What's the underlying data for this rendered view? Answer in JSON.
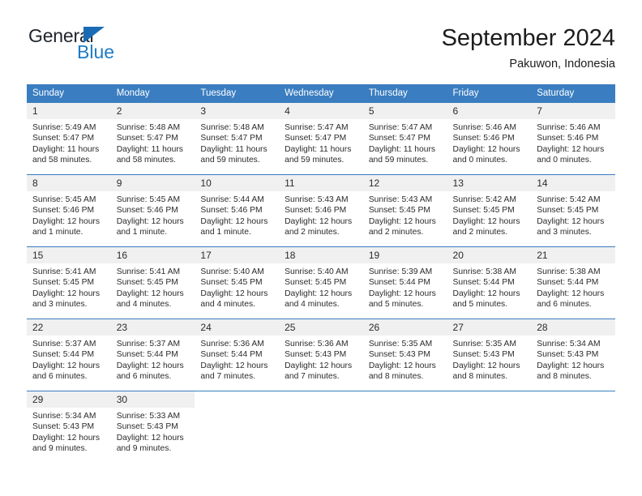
{
  "logo": {
    "word_top": "General",
    "word_bottom": "Blue",
    "triangle_color": "#1a6bb5",
    "blue_color": "#1f7bc4"
  },
  "header": {
    "title": "September 2024",
    "location": "Pakuwon, Indonesia"
  },
  "theme": {
    "header_blue": "#3a7dc0",
    "day_band_gray": "#f0f0f0",
    "text": "#2b2b2b"
  },
  "weekday_headers": [
    "Sunday",
    "Monday",
    "Tuesday",
    "Wednesday",
    "Thursday",
    "Friday",
    "Saturday"
  ],
  "weeks": [
    [
      {
        "day": "1",
        "sunrise": "Sunrise: 5:49 AM",
        "sunset": "Sunset: 5:47 PM",
        "daylight_l1": "Daylight: 11 hours",
        "daylight_l2": "and 58 minutes."
      },
      {
        "day": "2",
        "sunrise": "Sunrise: 5:48 AM",
        "sunset": "Sunset: 5:47 PM",
        "daylight_l1": "Daylight: 11 hours",
        "daylight_l2": "and 58 minutes."
      },
      {
        "day": "3",
        "sunrise": "Sunrise: 5:48 AM",
        "sunset": "Sunset: 5:47 PM",
        "daylight_l1": "Daylight: 11 hours",
        "daylight_l2": "and 59 minutes."
      },
      {
        "day": "4",
        "sunrise": "Sunrise: 5:47 AM",
        "sunset": "Sunset: 5:47 PM",
        "daylight_l1": "Daylight: 11 hours",
        "daylight_l2": "and 59 minutes."
      },
      {
        "day": "5",
        "sunrise": "Sunrise: 5:47 AM",
        "sunset": "Sunset: 5:47 PM",
        "daylight_l1": "Daylight: 11 hours",
        "daylight_l2": "and 59 minutes."
      },
      {
        "day": "6",
        "sunrise": "Sunrise: 5:46 AM",
        "sunset": "Sunset: 5:46 PM",
        "daylight_l1": "Daylight: 12 hours",
        "daylight_l2": "and 0 minutes."
      },
      {
        "day": "7",
        "sunrise": "Sunrise: 5:46 AM",
        "sunset": "Sunset: 5:46 PM",
        "daylight_l1": "Daylight: 12 hours",
        "daylight_l2": "and 0 minutes."
      }
    ],
    [
      {
        "day": "8",
        "sunrise": "Sunrise: 5:45 AM",
        "sunset": "Sunset: 5:46 PM",
        "daylight_l1": "Daylight: 12 hours",
        "daylight_l2": "and 1 minute."
      },
      {
        "day": "9",
        "sunrise": "Sunrise: 5:45 AM",
        "sunset": "Sunset: 5:46 PM",
        "daylight_l1": "Daylight: 12 hours",
        "daylight_l2": "and 1 minute."
      },
      {
        "day": "10",
        "sunrise": "Sunrise: 5:44 AM",
        "sunset": "Sunset: 5:46 PM",
        "daylight_l1": "Daylight: 12 hours",
        "daylight_l2": "and 1 minute."
      },
      {
        "day": "11",
        "sunrise": "Sunrise: 5:43 AM",
        "sunset": "Sunset: 5:46 PM",
        "daylight_l1": "Daylight: 12 hours",
        "daylight_l2": "and 2 minutes."
      },
      {
        "day": "12",
        "sunrise": "Sunrise: 5:43 AM",
        "sunset": "Sunset: 5:45 PM",
        "daylight_l1": "Daylight: 12 hours",
        "daylight_l2": "and 2 minutes."
      },
      {
        "day": "13",
        "sunrise": "Sunrise: 5:42 AM",
        "sunset": "Sunset: 5:45 PM",
        "daylight_l1": "Daylight: 12 hours",
        "daylight_l2": "and 2 minutes."
      },
      {
        "day": "14",
        "sunrise": "Sunrise: 5:42 AM",
        "sunset": "Sunset: 5:45 PM",
        "daylight_l1": "Daylight: 12 hours",
        "daylight_l2": "and 3 minutes."
      }
    ],
    [
      {
        "day": "15",
        "sunrise": "Sunrise: 5:41 AM",
        "sunset": "Sunset: 5:45 PM",
        "daylight_l1": "Daylight: 12 hours",
        "daylight_l2": "and 3 minutes."
      },
      {
        "day": "16",
        "sunrise": "Sunrise: 5:41 AM",
        "sunset": "Sunset: 5:45 PM",
        "daylight_l1": "Daylight: 12 hours",
        "daylight_l2": "and 4 minutes."
      },
      {
        "day": "17",
        "sunrise": "Sunrise: 5:40 AM",
        "sunset": "Sunset: 5:45 PM",
        "daylight_l1": "Daylight: 12 hours",
        "daylight_l2": "and 4 minutes."
      },
      {
        "day": "18",
        "sunrise": "Sunrise: 5:40 AM",
        "sunset": "Sunset: 5:45 PM",
        "daylight_l1": "Daylight: 12 hours",
        "daylight_l2": "and 4 minutes."
      },
      {
        "day": "19",
        "sunrise": "Sunrise: 5:39 AM",
        "sunset": "Sunset: 5:44 PM",
        "daylight_l1": "Daylight: 12 hours",
        "daylight_l2": "and 5 minutes."
      },
      {
        "day": "20",
        "sunrise": "Sunrise: 5:38 AM",
        "sunset": "Sunset: 5:44 PM",
        "daylight_l1": "Daylight: 12 hours",
        "daylight_l2": "and 5 minutes."
      },
      {
        "day": "21",
        "sunrise": "Sunrise: 5:38 AM",
        "sunset": "Sunset: 5:44 PM",
        "daylight_l1": "Daylight: 12 hours",
        "daylight_l2": "and 6 minutes."
      }
    ],
    [
      {
        "day": "22",
        "sunrise": "Sunrise: 5:37 AM",
        "sunset": "Sunset: 5:44 PM",
        "daylight_l1": "Daylight: 12 hours",
        "daylight_l2": "and 6 minutes."
      },
      {
        "day": "23",
        "sunrise": "Sunrise: 5:37 AM",
        "sunset": "Sunset: 5:44 PM",
        "daylight_l1": "Daylight: 12 hours",
        "daylight_l2": "and 6 minutes."
      },
      {
        "day": "24",
        "sunrise": "Sunrise: 5:36 AM",
        "sunset": "Sunset: 5:44 PM",
        "daylight_l1": "Daylight: 12 hours",
        "daylight_l2": "and 7 minutes."
      },
      {
        "day": "25",
        "sunrise": "Sunrise: 5:36 AM",
        "sunset": "Sunset: 5:43 PM",
        "daylight_l1": "Daylight: 12 hours",
        "daylight_l2": "and 7 minutes."
      },
      {
        "day": "26",
        "sunrise": "Sunrise: 5:35 AM",
        "sunset": "Sunset: 5:43 PM",
        "daylight_l1": "Daylight: 12 hours",
        "daylight_l2": "and 8 minutes."
      },
      {
        "day": "27",
        "sunrise": "Sunrise: 5:35 AM",
        "sunset": "Sunset: 5:43 PM",
        "daylight_l1": "Daylight: 12 hours",
        "daylight_l2": "and 8 minutes."
      },
      {
        "day": "28",
        "sunrise": "Sunrise: 5:34 AM",
        "sunset": "Sunset: 5:43 PM",
        "daylight_l1": "Daylight: 12 hours",
        "daylight_l2": "and 8 minutes."
      }
    ],
    [
      {
        "day": "29",
        "sunrise": "Sunrise: 5:34 AM",
        "sunset": "Sunset: 5:43 PM",
        "daylight_l1": "Daylight: 12 hours",
        "daylight_l2": "and 9 minutes."
      },
      {
        "day": "30",
        "sunrise": "Sunrise: 5:33 AM",
        "sunset": "Sunset: 5:43 PM",
        "daylight_l1": "Daylight: 12 hours",
        "daylight_l2": "and 9 minutes."
      },
      {
        "day": "",
        "sunrise": "",
        "sunset": "",
        "daylight_l1": "",
        "daylight_l2": ""
      },
      {
        "day": "",
        "sunrise": "",
        "sunset": "",
        "daylight_l1": "",
        "daylight_l2": ""
      },
      {
        "day": "",
        "sunrise": "",
        "sunset": "",
        "daylight_l1": "",
        "daylight_l2": ""
      },
      {
        "day": "",
        "sunrise": "",
        "sunset": "",
        "daylight_l1": "",
        "daylight_l2": ""
      },
      {
        "day": "",
        "sunrise": "",
        "sunset": "",
        "daylight_l1": "",
        "daylight_l2": ""
      }
    ]
  ]
}
